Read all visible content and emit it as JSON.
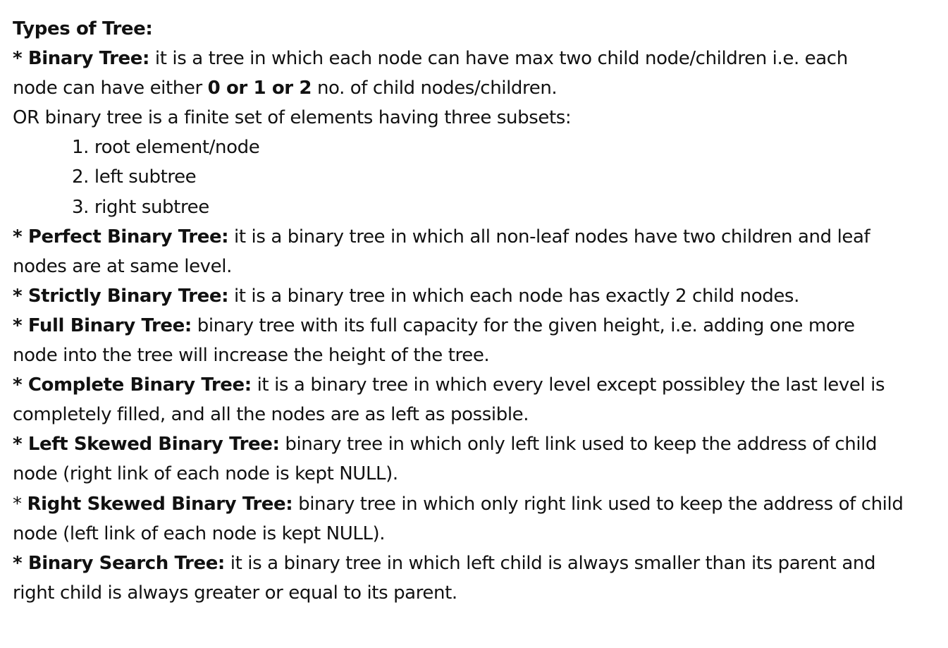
{
  "heading": "Types of Tree:",
  "binary_tree": {
    "term": "* Binary Tree:",
    "def_line1": " it is a tree in which each node can have max two child node/children i.e. each",
    "def_line2_pre": "node can have either ",
    "def_line2_bold": "0 or 1 or 2",
    "def_line2_post": " no. of child nodes/children.",
    "alt_definition": "OR binary tree is a finite set of elements having three subsets:",
    "subsets": [
      "1. root element/node",
      "2. left subtree",
      "3. right subtree"
    ]
  },
  "perfect": {
    "term": "* Perfect Binary Tree:",
    "def_line1": " it is a binary tree in which all non-leaf nodes have two children and leaf",
    "def_line2": "nodes are at same level."
  },
  "strictly": {
    "term": "* Strictly Binary Tree:",
    "def_line1": " it is a binary tree in which each node has exactly 2 child nodes."
  },
  "full": {
    "term": "* Full Binary Tree:",
    "def_line1": " binary tree with its full capacity for the given height, i.e. adding one more",
    "def_line2": "node into the tree will increase the height of the tree."
  },
  "complete": {
    "term": "* Complete Binary Tree:",
    "def_line1": " it is a binary tree in which every level except possibley the last level is",
    "def_line2": "completely filled, and all the nodes are as left as possible."
  },
  "left_skewed": {
    "term": "* Left Skewed Binary Tree:",
    "def_line1": " binary tree in which only left link used to keep the address of child",
    "def_line2": "node (right link of each node is kept NULL)."
  },
  "right_skewed": {
    "star": "* ",
    "term": "Right Skewed Binary Tree:",
    "def_line1": " binary tree in which only right link used to keep the address of child",
    "def_line2": "node (left link of each node is kept NULL)."
  },
  "bst": {
    "term": "* Binary Search Tree:",
    "def_line1": " it is a binary tree in which left child is always smaller than its parent and",
    "def_line2": "right child is always greater or equal to its parent."
  }
}
